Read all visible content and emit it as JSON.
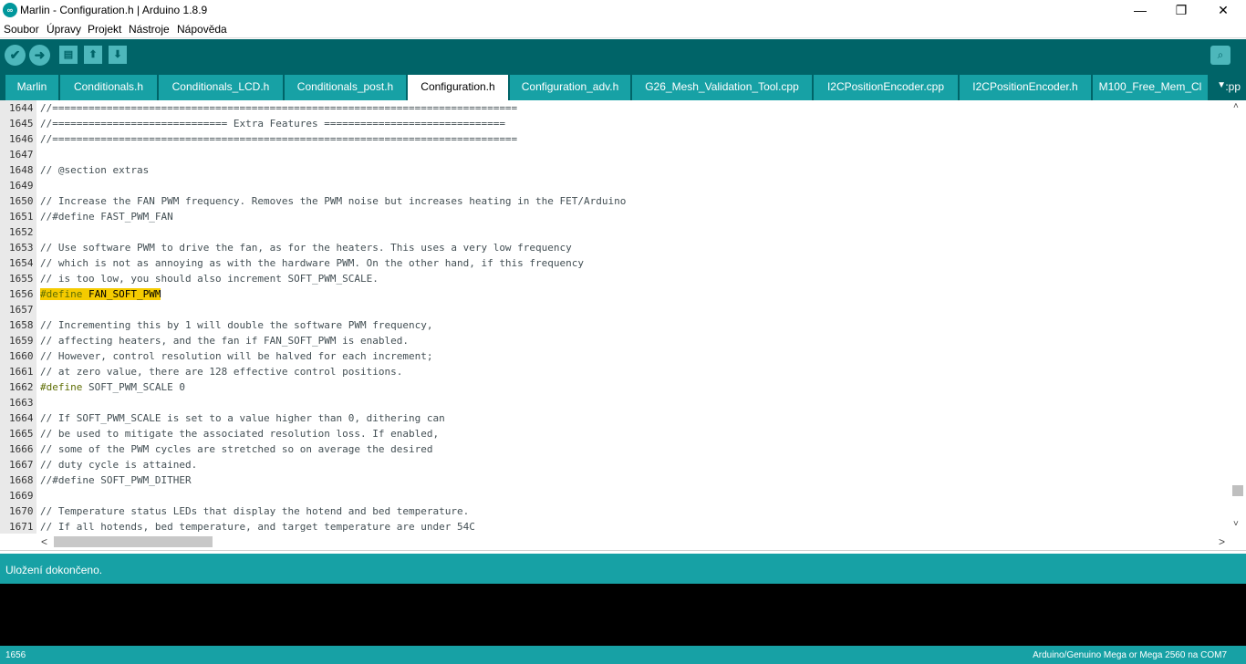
{
  "window": {
    "title": "Marlin - Configuration.h | Arduino 1.8.9",
    "app_icon_glyph": "∞",
    "buttons": {
      "minimize": "—",
      "maximize": "❐",
      "close": "✕"
    }
  },
  "menu": [
    "Soubor",
    "Úpravy",
    "Projekt",
    "Nástroje",
    "Nápověda"
  ],
  "toolbar": {
    "verify_icon": "✔",
    "upload_icon": "➜",
    "new_icon": "▤",
    "open_icon": "⬆",
    "save_icon": "⬇",
    "serial_icon": "⌕"
  },
  "tabs": [
    "Marlin",
    "Conditionals.h",
    "Conditionals_LCD.h",
    "Conditionals_post.h",
    "Configuration.h",
    "Configuration_adv.h",
    "G26_Mesh_Validation_Tool.cpp",
    "I2CPositionEncoder.cpp",
    "I2CPositionEncoder.h",
    "M100_Free_Mem_Cl"
  ],
  "active_tab": "Configuration.h",
  "tab_menu_glyph": "▼",
  "tab_overflow_text": ":pp",
  "code": [
    {
      "n": "1644",
      "t": "//============================================================================="
    },
    {
      "n": "1645",
      "t": "//============================= Extra Features =============================="
    },
    {
      "n": "1646",
      "t": "//============================================================================="
    },
    {
      "n": "1647",
      "t": ""
    },
    {
      "n": "1648",
      "t": "// @section extras"
    },
    {
      "n": "1649",
      "t": ""
    },
    {
      "n": "1650",
      "t": "// Increase the FAN PWM frequency. Removes the PWM noise but increases heating in the FET/Arduino"
    },
    {
      "n": "1651",
      "t": "//#define FAST_PWM_FAN"
    },
    {
      "n": "1652",
      "t": ""
    },
    {
      "n": "1653",
      "t": "// Use software PWM to drive the fan, as for the heaters. This uses a very low frequency"
    },
    {
      "n": "1654",
      "t": "// which is not as annoying as with the hardware PWM. On the other hand, if this frequency"
    },
    {
      "n": "1655",
      "t": "// is too low, you should also increment SOFT_PWM_SCALE."
    },
    {
      "n": "1656",
      "kw": "#define",
      "rest": " FAN_SOFT_PWM",
      "hl": true
    },
    {
      "n": "1657",
      "t": ""
    },
    {
      "n": "1658",
      "t": "// Incrementing this by 1 will double the software PWM frequency,"
    },
    {
      "n": "1659",
      "t": "// affecting heaters, and the fan if FAN_SOFT_PWM is enabled."
    },
    {
      "n": "1660",
      "t": "// However, control resolution will be halved for each increment;"
    },
    {
      "n": "1661",
      "t": "// at zero value, there are 128 effective control positions."
    },
    {
      "n": "1662",
      "kw": "#define",
      "rest": " SOFT_PWM_SCALE 0"
    },
    {
      "n": "1663",
      "t": ""
    },
    {
      "n": "1664",
      "t": "// If SOFT_PWM_SCALE is set to a value higher than 0, dithering can"
    },
    {
      "n": "1665",
      "t": "// be used to mitigate the associated resolution loss. If enabled,"
    },
    {
      "n": "1666",
      "t": "// some of the PWM cycles are stretched so on average the desired"
    },
    {
      "n": "1667",
      "t": "// duty cycle is attained."
    },
    {
      "n": "1668",
      "t": "//#define SOFT_PWM_DITHER"
    },
    {
      "n": "1669",
      "t": ""
    },
    {
      "n": "1670",
      "t": "// Temperature status LEDs that display the hotend and bed temperature."
    },
    {
      "n": "1671",
      "t": "// If all hotends, bed temperature, and target temperature are under 54C"
    }
  ],
  "scroll": {
    "up": "˄",
    "down": "˅",
    "left": "<",
    "right": ">"
  },
  "status_message": "Uložení dokončeno.",
  "footer": {
    "line_number": "1656",
    "board": "Arduino/Genuino Mega or Mega 2560 na COM7"
  }
}
